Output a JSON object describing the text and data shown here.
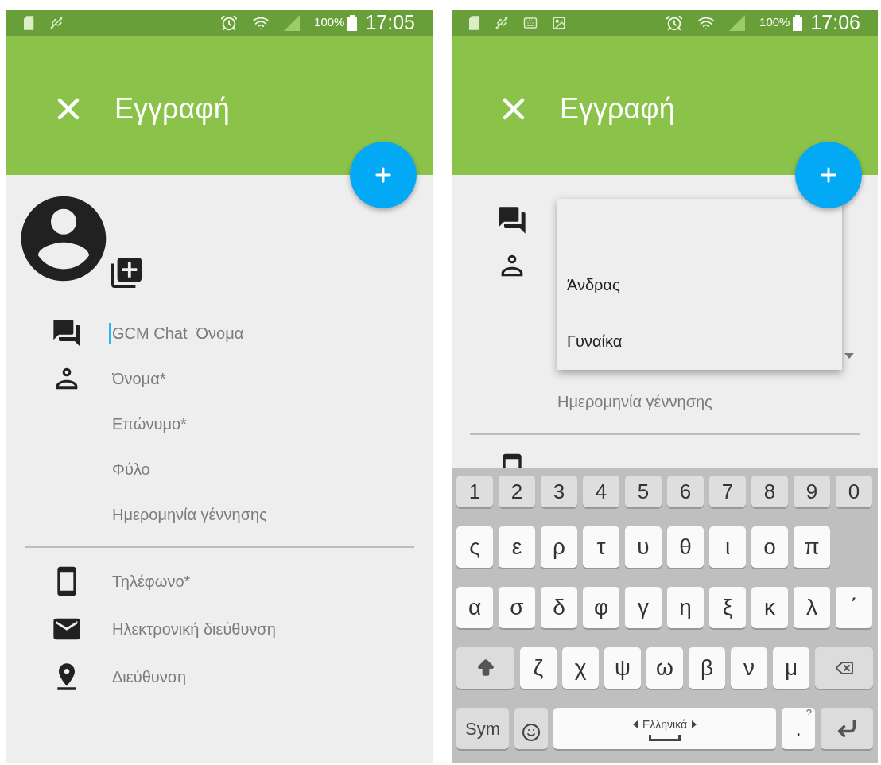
{
  "phones": [
    {
      "status_bar": {
        "notification_icons": [
          {
            "kind": "card"
          },
          {
            "kind": "usb"
          }
        ],
        "battery": "100%",
        "time": "17:05"
      },
      "app_bar": {
        "title": "Εγγραφή"
      },
      "avatar": true,
      "sections": [
        [
          {
            "kind": "text",
            "placeholder": "GCM Chat  Όνομα",
            "focused": true
          },
          {
            "kind": "text",
            "placeholder": "Όνομα*",
            "focused": false
          },
          {
            "kind": "text",
            "placeholder": "Επώνυμο*",
            "focused": false
          },
          {
            "kind": "select",
            "placeholder": "Φύλο",
            "expanded": false
          },
          {
            "kind": "text",
            "placeholder": "Ημερομηνία γέννησης",
            "focused": false
          }
        ],
        [
          {
            "kind": "text",
            "placeholder": "Τηλέφωνο*",
            "focused": false
          },
          {
            "kind": "text",
            "placeholder": "Ηλεκτρονική διεύθυνση",
            "focused": false
          },
          {
            "kind": "text",
            "placeholder": "Διεύθυνση",
            "focused": false
          }
        ]
      ]
    },
    {
      "status_bar": {
        "notification_icons": [
          {
            "kind": "card"
          },
          {
            "kind": "usb"
          },
          {
            "kind": "keyboard"
          },
          {
            "kind": "image"
          }
        ],
        "battery": "100%",
        "time": "17:06"
      },
      "app_bar": {
        "title": "Εγγραφή"
      },
      "avatar": false,
      "sections": [
        [
          {
            "kind": "text"
          },
          {
            "kind": "text"
          },
          {
            "kind": "text"
          },
          {
            "kind": "select",
            "expanded": true,
            "options": [
              {
                "label": "Άνδρας"
              },
              {
                "label": "Γυναίκα"
              }
            ]
          },
          {
            "kind": "text",
            "placeholder": "Ημερομηνία γέννησης",
            "focused": false
          }
        ],
        [
          {
            "kind": "text"
          }
        ]
      ],
      "keyboard": {
        "language": "Ελληνικά",
        "rows": [
          [
            {
              "kind": "number",
              "label": "1"
            },
            {
              "kind": "number",
              "label": "2"
            },
            {
              "kind": "number",
              "label": "3"
            },
            {
              "kind": "number",
              "label": "4"
            },
            {
              "kind": "number",
              "label": "5"
            },
            {
              "kind": "number",
              "label": "6"
            },
            {
              "kind": "number",
              "label": "7"
            },
            {
              "kind": "number",
              "label": "8"
            },
            {
              "kind": "number",
              "label": "9"
            },
            {
              "kind": "number",
              "label": "0"
            }
          ],
          [
            {
              "kind": "letter",
              "label": "ς"
            },
            {
              "kind": "letter",
              "label": "ε"
            },
            {
              "kind": "letter",
              "label": "ρ"
            },
            {
              "kind": "letter",
              "label": "τ"
            },
            {
              "kind": "letter",
              "label": "υ"
            },
            {
              "kind": "letter",
              "label": "θ"
            },
            {
              "kind": "letter",
              "label": "ι"
            },
            {
              "kind": "letter",
              "label": "ο"
            },
            {
              "kind": "letter",
              "label": "π"
            }
          ],
          [
            {
              "kind": "letter",
              "label": "α"
            },
            {
              "kind": "letter",
              "label": "σ"
            },
            {
              "kind": "letter",
              "label": "δ"
            },
            {
              "kind": "letter",
              "label": "φ"
            },
            {
              "kind": "letter",
              "label": "γ"
            },
            {
              "kind": "letter",
              "label": "η"
            },
            {
              "kind": "letter",
              "label": "ξ"
            },
            {
              "kind": "letter",
              "label": "κ"
            },
            {
              "kind": "letter",
              "label": "λ"
            },
            {
              "kind": "letter",
              "label": "΄"
            }
          ],
          [
            {
              "kind": "shift"
            },
            {
              "kind": "letter",
              "label": "ζ"
            },
            {
              "kind": "letter",
              "label": "χ"
            },
            {
              "kind": "letter",
              "label": "ψ"
            },
            {
              "kind": "letter",
              "label": "ω"
            },
            {
              "kind": "letter",
              "label": "β"
            },
            {
              "kind": "letter",
              "label": "ν"
            },
            {
              "kind": "letter",
              "label": "μ"
            },
            {
              "kind": "backspace"
            }
          ],
          [
            {
              "kind": "sym",
              "label": "Sym"
            },
            {
              "kind": "emoji"
            },
            {
              "kind": "space"
            },
            {
              "kind": "symbol",
              "label": ".",
              "hint": "?"
            },
            {
              "kind": "enter"
            }
          ]
        ]
      }
    }
  ]
}
